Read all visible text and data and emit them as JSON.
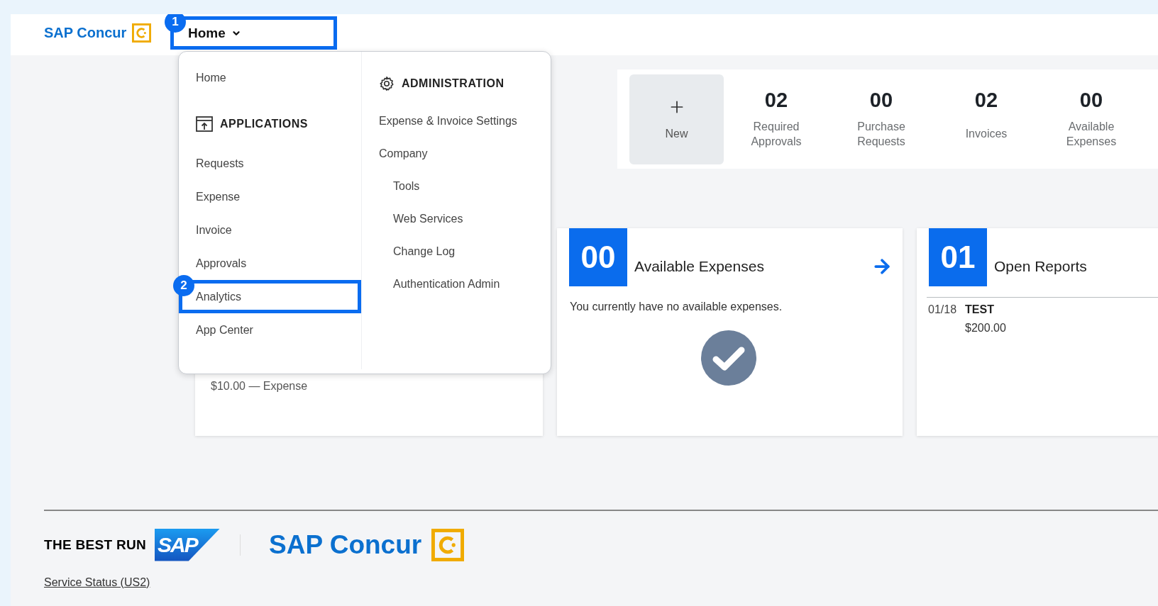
{
  "header": {
    "logo": "SAP Concur",
    "nav_button": {
      "label": "Home",
      "expanded": true,
      "callout": "1"
    }
  },
  "menu": {
    "home": "Home",
    "applications": {
      "heading": "APPLICATIONS",
      "items": [
        {
          "label": "Requests"
        },
        {
          "label": "Expense"
        },
        {
          "label": "Invoice"
        },
        {
          "label": "Approvals"
        },
        {
          "label": "Analytics",
          "callout": "2"
        },
        {
          "label": "App Center"
        }
      ]
    },
    "administration": {
      "heading": "ADMINISTRATION",
      "items": [
        {
          "label": "Expense & Invoice Settings"
        },
        {
          "label": "Company",
          "children": [
            {
              "label": "Tools"
            },
            {
              "label": "Web Services"
            },
            {
              "label": "Change Log"
            },
            {
              "label": "Authentication Admin"
            }
          ]
        }
      ]
    }
  },
  "stats": {
    "new_label": "New",
    "items": [
      {
        "value": "02",
        "label": "Required Approvals"
      },
      {
        "value": "00",
        "label": "Purchase Requests"
      },
      {
        "value": "02",
        "label": "Invoices"
      },
      {
        "value": "00",
        "label": "Available Expenses"
      }
    ]
  },
  "cards": [
    {
      "kind": "partial",
      "text": "$10.00 — Expense"
    },
    {
      "kind": "empty",
      "count": "00",
      "title": "Available Expenses",
      "message": "You currently have no available expenses."
    },
    {
      "kind": "list",
      "count": "01",
      "title": "Open Reports",
      "rows": [
        {
          "date": "01/18",
          "name": "TEST",
          "amount": "$200.00"
        }
      ]
    }
  ],
  "footer": {
    "tagline": "THE BEST RUN",
    "sap_logo": "SAP",
    "brand": "SAP Concur",
    "link": "Service Status (US2)"
  }
}
